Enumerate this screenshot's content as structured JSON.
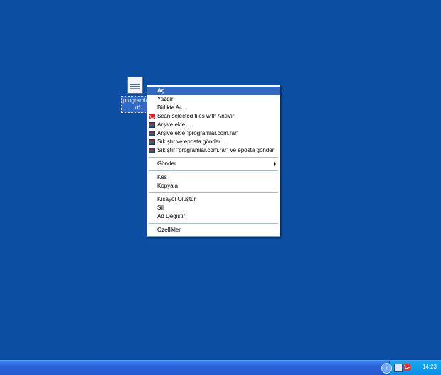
{
  "desktop": {
    "icon_label_line1": "programlar",
    "icon_label_line2": ".rtf"
  },
  "context_menu": {
    "items": {
      "open": "Aç",
      "print": "Yazdır",
      "open_with": "Birlikte Aç...",
      "scan": "Scan selected files with AntiVir",
      "add_archive": "Arşive ekle...",
      "add_named_archive": "Arşive ekle \"programlar.com.rar\"",
      "compress_email": "Sıkıştır ve eposta gönder...",
      "compress_named_email": "Sıkıştır \"programlar.com.rar\" ve eposta gönder",
      "send_to": "Gönder",
      "cut": "Kes",
      "copy": "Kopyala",
      "create_shortcut": "Kısayol Oluştur",
      "delete": "Sil",
      "rename": "Ad Değiştir",
      "properties": "Özellikler"
    }
  },
  "taskbar": {
    "clock": "14:23",
    "tray_arrow": "‹"
  },
  "colors": {
    "desktop": "#0c4ea2",
    "highlight": "#316ac5",
    "taskbar": "#245ad0",
    "tray": "#0d8ee3"
  }
}
